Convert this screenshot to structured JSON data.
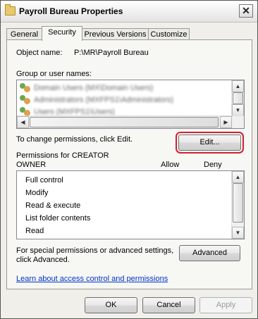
{
  "window": {
    "title": "Payroll Bureau Properties"
  },
  "tabs": [
    {
      "label": "General"
    },
    {
      "label": "Security"
    },
    {
      "label": "Previous Versions"
    },
    {
      "label": "Customize"
    }
  ],
  "security": {
    "object_name_label": "Object name:",
    "object_name_value": "P:\\MR\\Payroll Bureau",
    "group_label": "Group or user names:",
    "users": [
      {
        "name": "Domain Users (MX\\Domain Users)"
      },
      {
        "name": "Administrators (MXFPS1\\Administrators)"
      },
      {
        "name": "Users (MXFPS1\\Users)"
      }
    ],
    "change_text": "To change permissions, click Edit.",
    "edit_button": "Edit...",
    "permissions_for_line1": "Permissions for CREATOR",
    "permissions_for_line2": "OWNER",
    "allow_header": "Allow",
    "deny_header": "Deny",
    "permissions": [
      {
        "name": "Full control"
      },
      {
        "name": "Modify"
      },
      {
        "name": "Read & execute"
      },
      {
        "name": "List folder contents"
      },
      {
        "name": "Read"
      }
    ],
    "special_line1": "For special permissions or advanced settings,",
    "special_line2": "click Advanced.",
    "advanced_button": "Advanced",
    "learn_link": "Learn about access control and permissions"
  },
  "footer": {
    "ok": "OK",
    "cancel": "Cancel",
    "apply": "Apply"
  },
  "icons": {
    "window": "folder-icon",
    "close": "close-icon",
    "user": "users-group-icon"
  },
  "colors": {
    "highlight": "#d2202f",
    "link": "#0033cc"
  }
}
